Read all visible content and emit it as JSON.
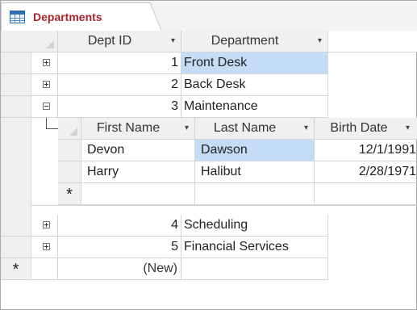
{
  "tab": {
    "label": "Departments",
    "icon": "table-icon"
  },
  "headers": {
    "dept_id": "Dept ID",
    "department": "Department"
  },
  "dropdown_glyph": "▾",
  "departments": [
    {
      "id": "1",
      "name": "Front Desk",
      "expander": "+"
    },
    {
      "id": "2",
      "name": "Back Desk",
      "expander": "+"
    },
    {
      "id": "3",
      "name": "Maintenance",
      "expander": "−"
    },
    {
      "id": "4",
      "name": "Scheduling",
      "expander": "+"
    },
    {
      "id": "5",
      "name": "Financial Services",
      "expander": "+"
    }
  ],
  "subdatasheet": {
    "headers": {
      "first_name": "First Name",
      "last_name": "Last Name",
      "birth_date": "Birth Date"
    },
    "rows": [
      {
        "first": "Devon",
        "last": "Dawson",
        "birth": "12/1/1991"
      },
      {
        "first": "Harry",
        "last": "Halibut",
        "birth": "2/28/1971"
      }
    ],
    "new_row_marker": "*"
  },
  "new_record": {
    "marker": "*",
    "label": "(New)"
  },
  "colors": {
    "tab_text": "#a4262c",
    "selection": "#c5dcf7",
    "header_bg": "#f0f0f0"
  }
}
